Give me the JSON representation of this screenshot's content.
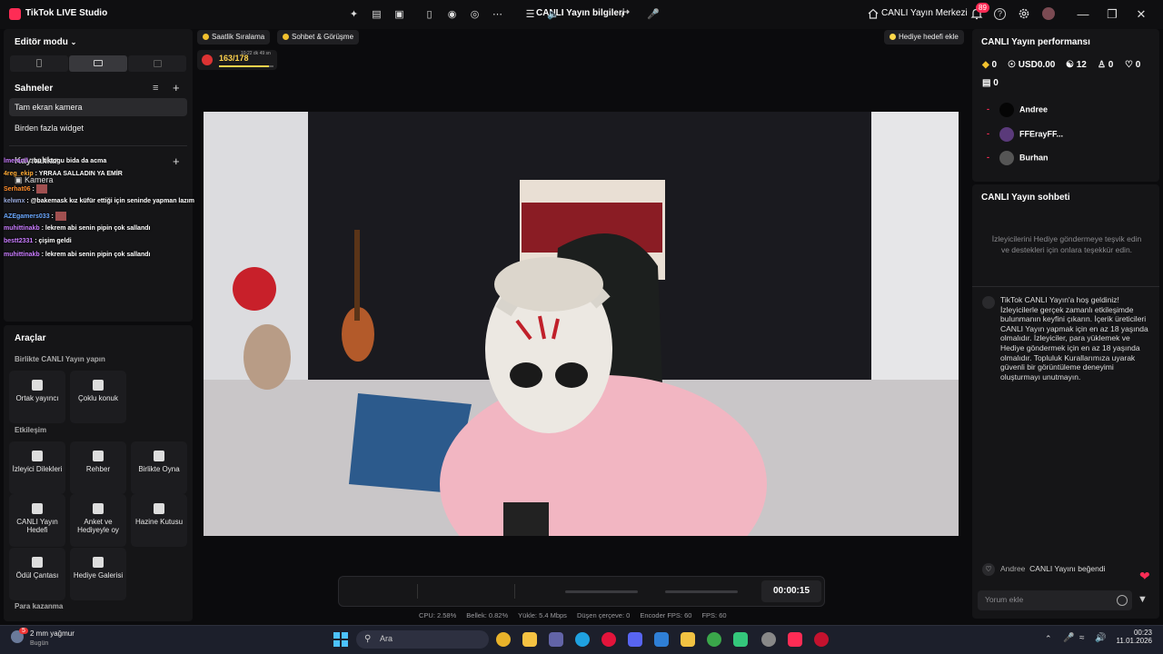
{
  "titlebar": {
    "app": "TikTok LIVE Studio",
    "center_title": "CANLI Yayın bilgileri",
    "center_link": "CANLI Yayın Merkezi",
    "notifications": "89"
  },
  "left": {
    "editor_mode": "Editör modu",
    "scenes_title": "Sahneler",
    "scenes": [
      "Tam ekran kamera",
      "Birden fazla widget"
    ],
    "sources_title": "Kaynaklar",
    "camera": "Kamera"
  },
  "chat_overlay": [
    {
      "user": "lmeranll",
      "text": ": bu tiktogu bida da acma"
    },
    {
      "user": "4reg_ekip",
      "text": ": YRRAA SALLADIN YA EMİR"
    },
    {
      "user": "Serhat06",
      "text": ":"
    },
    {
      "user": "kelwnx",
      "text": ": @bakemask kız küfür ettiği için seninde yapman lazım"
    },
    {
      "user": "AZEgamers033",
      "text": ":"
    },
    {
      "user": "muhittinakb",
      "text": ": lekrem abi senin pipin çok sallandı"
    },
    {
      "user": "bestt2331",
      "text": ": çişim geldi"
    },
    {
      "user": "muhittinakb",
      "text": ": lekrem abi senin pipin çok sallandı"
    }
  ],
  "tools": {
    "title": "Araçlar",
    "collab": "Birlikte CANLI Yayın yapın",
    "engagement": "Etkileşim",
    "earn": "Para kazanma",
    "items": [
      "Ortak yayıncı",
      "Çoklu konuk",
      "İzleyici Dilekleri",
      "Rehber",
      "Birlikte Oyna",
      "CANLI Yayın Hedefi",
      "Anket ve Hediyeyle oy",
      "Hazine Kutusu",
      "Ödül Çantası",
      "Hediye Galerisi"
    ]
  },
  "stage": {
    "pill1": "Saatlik Sıralama",
    "pill2": "Sohbet & Görüşme",
    "gift_goal": "Hediye hedefi ekle",
    "score": "163/178",
    "score_time": "10:22 dk 49 sn"
  },
  "controls": {
    "timer": "00:00:15",
    "stats": [
      "CPU:  2.58%",
      "Bellek:  0.82%",
      "Yükle:  5.4 Mbps",
      "Düşen çerçeve:  0",
      "Encoder FPS:  60",
      "FPS:  60"
    ]
  },
  "right": {
    "perf_title": "CANLI Yayın performansı",
    "stats": [
      "0",
      "USD0.00",
      "12",
      "0",
      "0",
      "0"
    ],
    "viewers": [
      {
        "rank": "-",
        "name": "Andree"
      },
      {
        "rank": "-",
        "name": "FFErayFF..."
      },
      {
        "rank": "-",
        "name": "Burhan"
      }
    ],
    "chat_title": "CANLI Yayın sohbeti",
    "prompt": "İzleyicilerini Hediye göndermeye teşvik edin ve destekleri için onlara teşekkür edin.",
    "welcome": "TikTok CANLI Yayın'a hoş geldiniz! İzleyicilerle gerçek zamanlı etkileşimde bulunmanın keyfini çıkarın. İçerik üreticileri CANLI Yayın yapmak için en az 18 yaşında olmalıdır. İzleyiciler, para yüklemek ve Hediye göndermek için en az 18 yaşında olmalıdır. Topluluk Kurallarımıza uyarak güvenli bir görüntüleme deneyimi oluşturmayı unutmayın.",
    "like_user": "Andree",
    "like_text": "CANLI Yayını beğendi",
    "comment_placeholder": "Yorum ekle"
  },
  "taskbar": {
    "weather": "2 mm yağmur",
    "weather_sub": "Bugün",
    "weather_badge": "5",
    "search": "Ara",
    "time": "00:23",
    "date": "11.01.2026"
  }
}
